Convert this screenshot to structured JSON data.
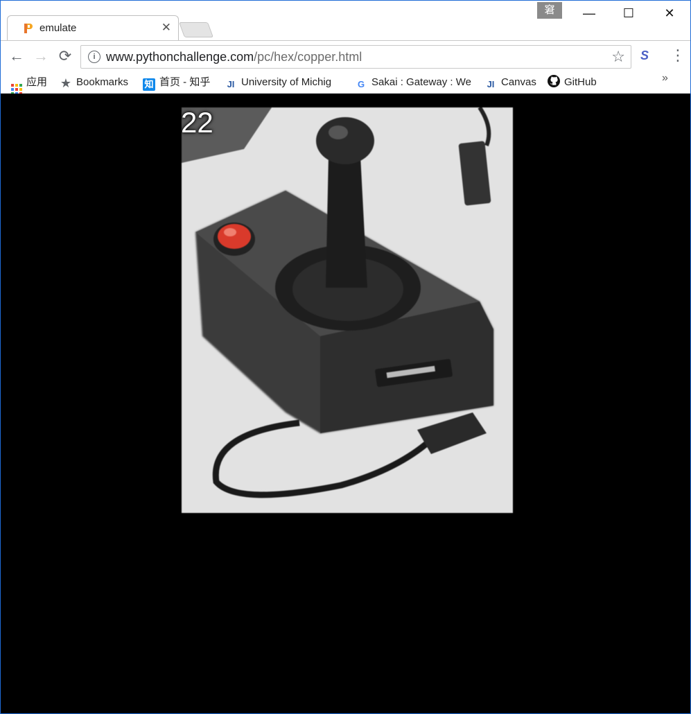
{
  "window": {
    "tab_title": "emulate",
    "ime_indicator": "窘",
    "controls": {
      "minimize": "—",
      "maximize": "☐",
      "close": "✕"
    }
  },
  "toolbar": {
    "back_icon": "←",
    "forward_icon": "→",
    "reload_icon": "⟳",
    "url_host": "www.pythonchallenge.com",
    "url_path": "/pc/hex/copper.html",
    "star_icon": "☆",
    "extension_icon": "S",
    "menu_icon": "⋮"
  },
  "bookmarks": [
    {
      "label": "应用",
      "icon": "apps-grid-icon"
    },
    {
      "label": "Bookmarks",
      "icon": "star-icon"
    },
    {
      "label": "首页 - 知乎",
      "icon": "zhihu-icon",
      "icon_text": "知"
    },
    {
      "label": "University of Michig",
      "icon": "ji-icon",
      "icon_text": "JI"
    },
    {
      "label": "Sakai : Gateway : We",
      "icon": "google-icon",
      "icon_text": "G"
    },
    {
      "label": "Canvas",
      "icon": "ji-icon",
      "icon_text": "JI"
    },
    {
      "label": "GitHub",
      "icon": "github-icon"
    }
  ],
  "bookmarks_overflow": "»",
  "content": {
    "level_number": "22",
    "image_description_icon": "joystick-photo"
  },
  "colors": {
    "page_background": "#000000",
    "border_accent": "#1e6bd6",
    "joystick_button": "#d93a2b"
  }
}
